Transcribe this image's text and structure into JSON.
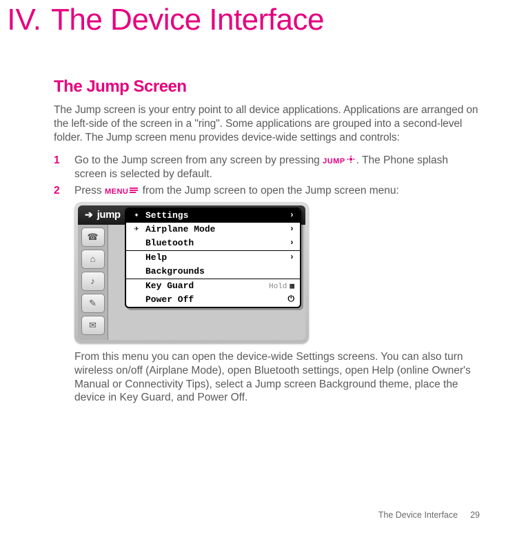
{
  "chapter": {
    "num": "IV.",
    "title": "The Device Interface"
  },
  "section": {
    "title": "The Jump Screen"
  },
  "intro": "The Jump screen is your entry point to all device applications. Applications are arranged on the left-side of the screen in a \"ring\". Some applications are grouped into a second-level folder. The Jump screen menu provides device-wide settings and controls:",
  "steps": {
    "s1": {
      "num": "1",
      "pre": "Go to the Jump screen from any screen by pressing ",
      "kw": "JUMP",
      "post": ". The Phone splash screen is selected by default."
    },
    "s2": {
      "num": "2",
      "pre": "Press ",
      "kw": "MENU",
      "post": " from the Jump screen to open the Jump screen menu:"
    }
  },
  "device": {
    "titlebar": "jump",
    "menu": {
      "settings": "Settings",
      "airplane": "Airplane Mode",
      "bluetooth": "Bluetooth",
      "help": "Help",
      "backgrounds": "Backgrounds",
      "keyguard": "Key Guard",
      "keyguard_hint": "Hold",
      "poweroff": "Power Off"
    }
  },
  "after_image": "From this menu you can open the device-wide Settings screens. You can also turn wireless on/off (Airplane Mode), open Bluetooth settings, open Help (online Owner's Manual or Connectivity Tips), select a Jump screen Background theme, place the device in Key Guard, and Power Off.",
  "footer": {
    "label": "The Device Interface",
    "page": "29"
  }
}
